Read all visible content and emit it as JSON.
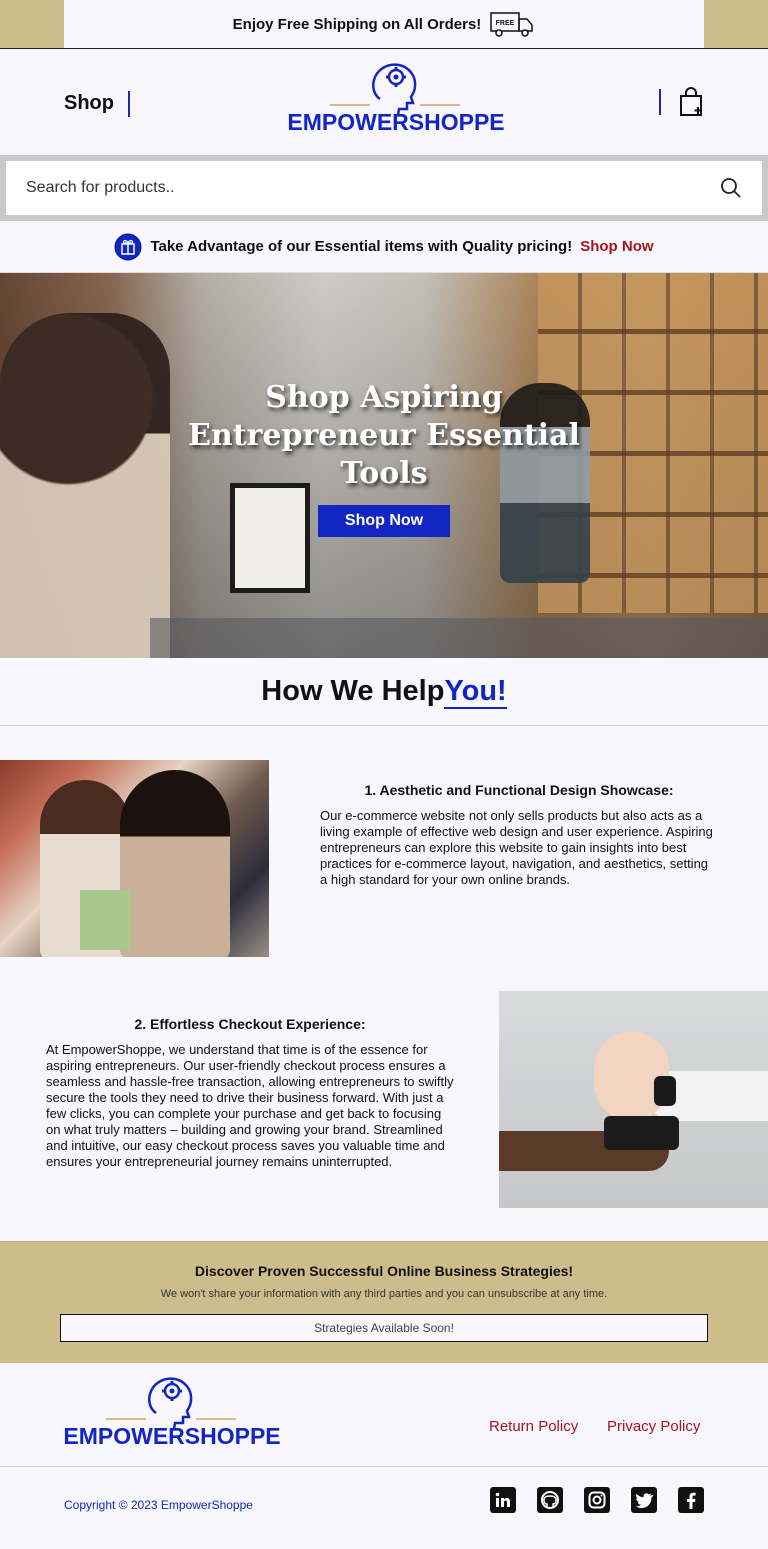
{
  "announcement": {
    "text": "Enjoy Free Shipping on All Orders!",
    "icon": "free-shipping-truck-icon",
    "badge": "FREE"
  },
  "header": {
    "shop_label": "Shop",
    "logo_text": "EMPOWERSHOPPE",
    "cart_icon": "shopping-bag-icon"
  },
  "search": {
    "placeholder": "Search for products..",
    "icon": "search-icon"
  },
  "promo": {
    "text": "Take Advantage of our Essential items with Quality pricing!",
    "link": "Shop Now",
    "icon": "gift-icon"
  },
  "hero": {
    "title": "Shop Aspiring Entrepreneur Essential Tools",
    "button": "Shop Now"
  },
  "help": {
    "title_main": "How We Help",
    "title_accent": "You!"
  },
  "features": [
    {
      "title": "1. Aesthetic and Functional Design Showcase:",
      "body": "Our e-commerce website not only sells products but also acts as a living example of effective web design and user experience. Aspiring entrepreneurs can explore this website to gain insights into best practices for e-commerce layout, navigation, and aesthetics, setting a high standard for your own online brands."
    },
    {
      "title": "2. Effortless Checkout Experience:",
      "body": "At EmpowerShoppe, we understand that time is of the essence for aspiring entrepreneurs. Our user-friendly checkout process ensures a seamless and hassle-free transaction, allowing entrepreneurs to swiftly secure the tools they need to drive their business forward. With just a few clicks, you can complete your purchase and get back to focusing on what truly matters – building and growing your brand. Streamlined and intuitive, our easy checkout process saves you valuable time and ensures your entrepreneurial journey remains uninterrupted."
    }
  ],
  "newsletter": {
    "title": "Discover Proven Successful Online Business Strategies!",
    "subtitle": "We won't share your information with any third parties and you can unsubscribe at any time.",
    "box_text": "Strategies Available Soon!"
  },
  "footer": {
    "logo_text": "EMPOWERSHOPPE",
    "return_policy": "Return Policy",
    "privacy_policy": "Privacy Policy",
    "copyright": "Copyright © 2023 EmpowerShoppe",
    "social": [
      "linkedin-icon",
      "github-icon",
      "instagram-icon",
      "twitter-icon",
      "facebook-icon"
    ]
  },
  "colors": {
    "accent": "#1326c4",
    "gold": "#cebd8c",
    "link_red": "#a8141b"
  }
}
